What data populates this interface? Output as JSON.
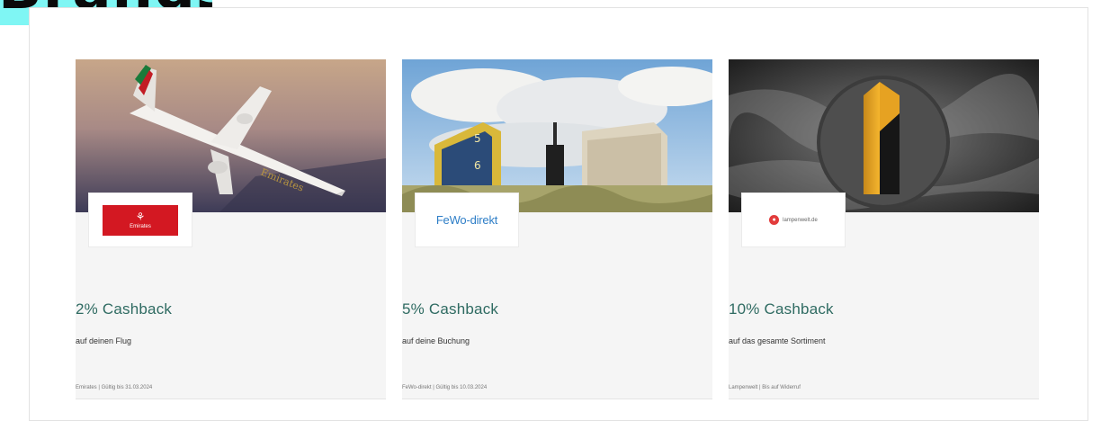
{
  "section": {
    "heading": "Brands"
  },
  "cards": [
    {
      "cashback": "2% Cashback",
      "subline": "auf deinen Flug",
      "meta": "Emirates | Gültig bis 31.03.2024",
      "logo_text": "Emirates",
      "image": "airplane-photo",
      "accent": "#d31822"
    },
    {
      "cashback": "5% Cashback",
      "subline": "auf deine Buchung",
      "meta": "FeWo-direkt | Gültig bis 10.03.2024",
      "logo_text": "FeWo-direkt",
      "image": "beach-chairs-photo",
      "accent": "#2e7ec7"
    },
    {
      "cashback": "10% Cashback",
      "subline": "auf das gesamte Sortiment",
      "meta": "Lampenwelt | Bis auf Widerruf",
      "logo_text": "lampenwelt.de",
      "image": "lamp-photo",
      "accent": "#e23b3b"
    }
  ],
  "colors": {
    "heading_badge": "#7ff6f4",
    "cashback_text": "#2f6b62",
    "card_background": "#f5f5f5"
  }
}
